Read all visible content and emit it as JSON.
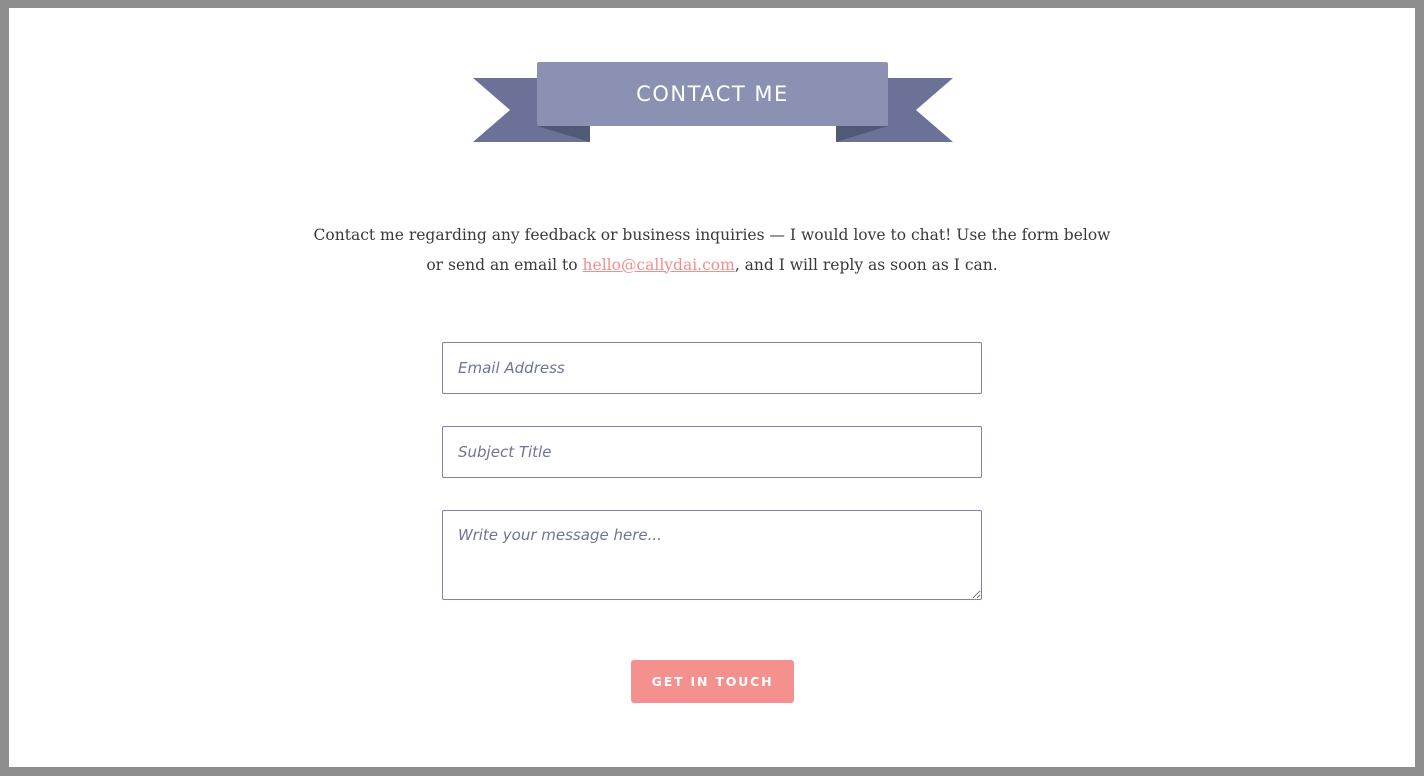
{
  "header": {
    "title": "CONTACT ME"
  },
  "intro": {
    "line_before_link": "Contact me regarding any feedback or business inquiries — I would love to chat! Use the form below or send an email to ",
    "email_link": "hello@callydai.com",
    "line_after_link": ", and I will reply as soon as I can."
  },
  "form": {
    "email_placeholder": "Email Address",
    "subject_placeholder": "Subject Title",
    "message_placeholder": "Write your message here...",
    "submit_label": "GET IN TOUCH"
  },
  "colors": {
    "ribbon_front": "#8a91b2",
    "ribbon_tail": "#6b7197",
    "ribbon_fold": "#525878",
    "accent": "#f4908e",
    "link": "#f28e8c"
  }
}
